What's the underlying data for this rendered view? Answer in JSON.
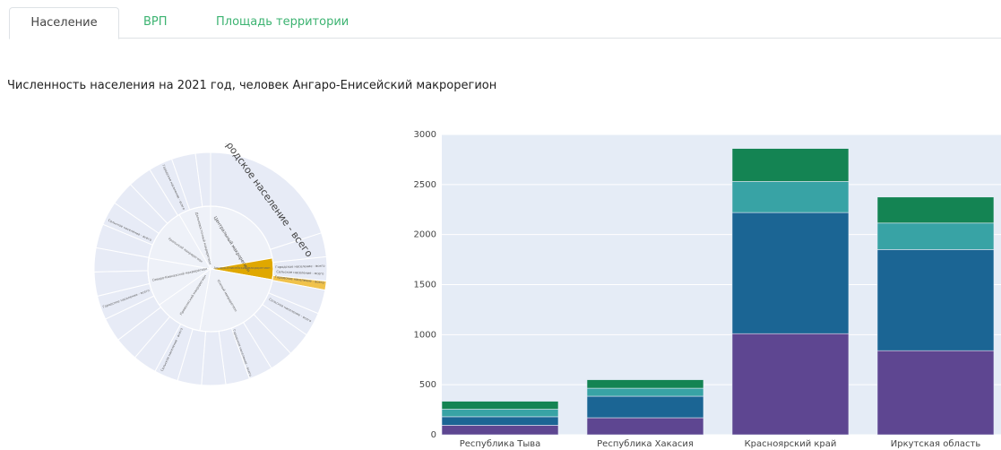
{
  "tabs": [
    {
      "label": "Население"
    },
    {
      "label": "ВРП"
    },
    {
      "label": "Площадь территории"
    }
  ],
  "title": "Численность населения на 2021 год, человек Ангаро-Енисейский макрорегион",
  "sunburst": {
    "inner": {
      "large_label": "Центральный макрорегион",
      "small_labels": [
        "Южный макрорегион",
        "Приволжский макрорегион",
        "Северо-Кавказский макрорегион",
        "Уральский макрорегион",
        "Дальневосточный макрорегион",
        "Ангаро-Енисейский макрорегион"
      ]
    },
    "outer": {
      "large_label": "Городское население - всего",
      "small_labels": [
        "Сельское население - всего",
        "Городское население - всего",
        "Сельское население - всего",
        "Городское население - всего",
        "Сельское население - всего",
        "Городское население - всего"
      ]
    },
    "highlight_labels": [
      "Городское население - всего",
      "Сельское население - всего",
      "Городское население - всего"
    ],
    "colors": {
      "base": "#e7ebf6",
      "highlight": "#f0c24b",
      "highlight_dark": "#e0a800"
    }
  },
  "chart_data": {
    "type": "bar",
    "stacked": true,
    "categories": [
      "Республика Тыва",
      "Республика Хакасия",
      "Красноярский край",
      "Иркутская область"
    ],
    "series": [
      {
        "color": "#5e4691",
        "values": [
          95,
          170,
          1010,
          840
        ]
      },
      {
        "color": "#1b6594",
        "values": [
          85,
          215,
          1210,
          1010
        ]
      },
      {
        "color": "#38a3a5",
        "values": [
          75,
          80,
          310,
          265
        ]
      },
      {
        "color": "#148453",
        "values": [
          80,
          85,
          330,
          260
        ]
      }
    ],
    "ylim": [
      0,
      3000
    ],
    "yticks": [
      0,
      500,
      1000,
      1500,
      2000,
      2500,
      3000
    ],
    "grid": true,
    "background": "#e5ecf6"
  }
}
